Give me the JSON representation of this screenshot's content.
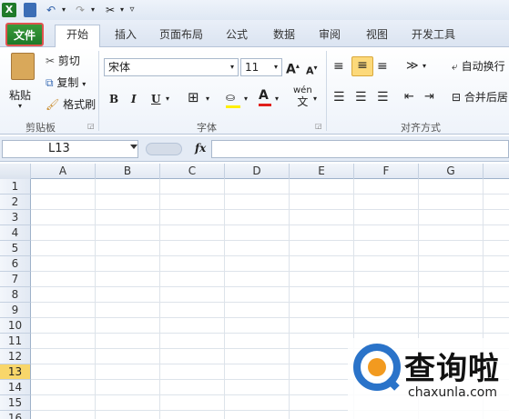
{
  "qat": {
    "icons": [
      "excel-logo-icon",
      "save-icon",
      "undo-icon",
      "redo-icon",
      "tools-icon",
      "customize-icon"
    ]
  },
  "tabs": [
    "文件",
    "开始",
    "插入",
    "页面布局",
    "公式",
    "数据",
    "审阅",
    "视图",
    "开发工具"
  ],
  "clipboard": {
    "paste": "粘贴",
    "cut": "剪切",
    "copy": "复制",
    "format_painter": "格式刷",
    "group": "剪贴板"
  },
  "font": {
    "name": "宋体",
    "size": "11",
    "bold": "B",
    "italic": "I",
    "underline": "U",
    "phonetic": "wén",
    "group": "字体"
  },
  "alignment": {
    "wrap_text": "自动换行",
    "merge_center": "合并后居",
    "group": "对齐方式"
  },
  "formula_bar": {
    "name_box": "L13",
    "fx": "fx",
    "formula": ""
  },
  "grid": {
    "columns": [
      "A",
      "B",
      "C",
      "D",
      "E",
      "F",
      "G"
    ],
    "rows": [
      "1",
      "2",
      "3",
      "4",
      "5",
      "6",
      "7",
      "8",
      "9",
      "10",
      "11",
      "12",
      "13",
      "14",
      "15",
      "16"
    ],
    "selected_row": "13"
  },
  "watermark": {
    "brand": "查询啦",
    "url": "chaxunla.com"
  },
  "colors": {
    "file_tab": "#1f7a2a",
    "accent_highlight": "#e0534f",
    "selected_row": "#f8d66a",
    "watermark_blue": "#2a73c9",
    "watermark_orange": "#f29a1f"
  }
}
